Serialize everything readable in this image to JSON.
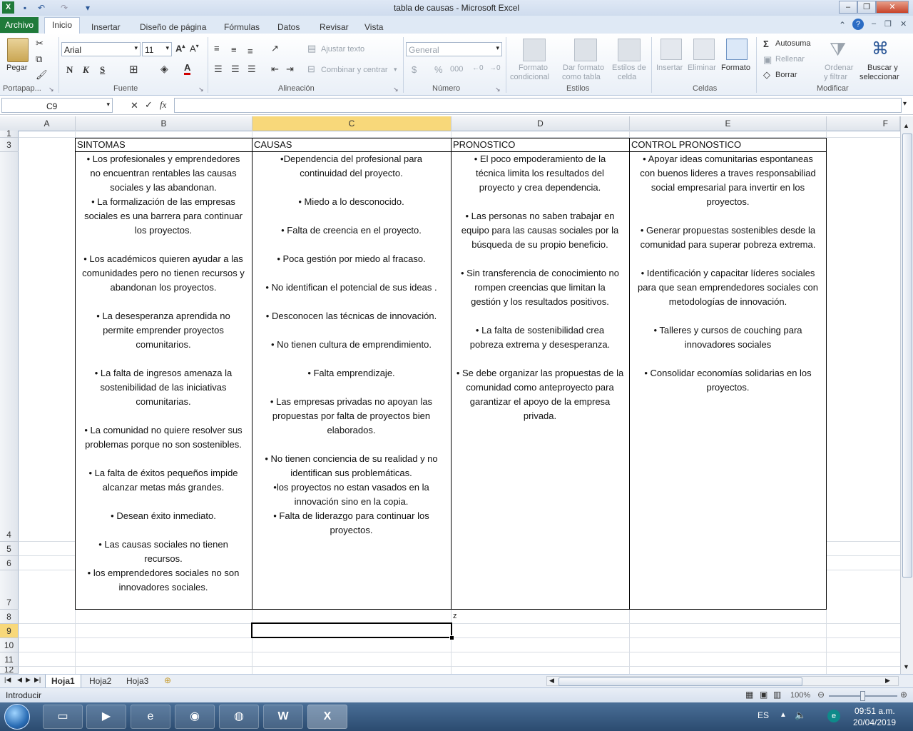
{
  "window": {
    "title": "tabla de causas - Microsoft Excel"
  },
  "tabs": [
    "Archivo",
    "Inicio",
    "Insertar",
    "Diseño de página",
    "Fórmulas",
    "Datos",
    "Revisar",
    "Vista"
  ],
  "ribbon": {
    "clipboard": {
      "paste": "Pegar",
      "group": "Portapap..."
    },
    "font": {
      "name": "Arial",
      "size": "11",
      "bold": "N",
      "italic": "K",
      "underline": "S",
      "color": "A",
      "group": "Fuente"
    },
    "alignment": {
      "wrap": "Ajustar texto",
      "merge": "Combinar y centrar",
      "group": "Alineación"
    },
    "number": {
      "format": "General",
      "currency": "$",
      "percent": "%",
      "thousands": "000",
      "group": "Número"
    },
    "styles": {
      "conditional_1": "Formato",
      "conditional_2": "condicional",
      "table_1": "Dar formato",
      "table_2": "como tabla",
      "cell_1": "Estilos de",
      "cell_2": "celda",
      "group": "Estilos"
    },
    "cells": {
      "insert": "Insertar",
      "delete": "Eliminar",
      "format": "Formato",
      "group": "Celdas"
    },
    "editing": {
      "autosum": "Autosuma",
      "fill": "Rellenar",
      "clear": "Borrar",
      "sort_1": "Ordenar",
      "sort_2": "y filtrar",
      "find_1": "Buscar y",
      "find_2": "seleccionar",
      "group": "Modificar"
    }
  },
  "formula_bar": {
    "name_box": "C9",
    "fx": "fx",
    "value": ""
  },
  "columns": [
    "A",
    "B",
    "C",
    "D",
    "E",
    "F"
  ],
  "rows": [
    "1",
    "3",
    "4",
    "5",
    "6",
    "7",
    "8",
    "9",
    "10",
    "11",
    "12"
  ],
  "table": {
    "headers": [
      "SINTOMAS",
      "CAUSAS",
      "PRONOSTICO",
      "CONTROL PRONOSTICO"
    ],
    "sintomas": "• Los profesionales y emprendedores\nno encuentran rentables las causas\nsociales y las abandonan.\n• La formalización de las empresas\nsociales es una barrera para continuar\nlos proyectos.\n\n• Los académicos quieren ayudar a las\ncomunidades pero no tienen recursos y\nabandonan los proyectos.\n\n• La desesperanza aprendida no\npermite emprender proyectos\ncomunitarios.\n\n• La falta de ingresos amenaza la\nsostenibilidad de las iniciativas\ncomunitarias.\n\n• La comunidad no quiere resolver sus\nproblemas porque no son sostenibles.\n\n• La falta de éxitos pequeños impide\nalcanzar metas más grandes.\n\n• Desean éxito inmediato.\n\n• Las causas sociales no tienen\nrecursos.\n• los emprendedores sociales no son\ninnovadores sociales.",
    "causas": "•Dependencia del profesional para\ncontinuidad del proyecto.\n\n• Miedo a lo desconocido.\n\n• Falta de creencia en el proyecto.\n\n• Poca  gestión por miedo al fracaso.\n\n• No identifican el potencial de sus ideas .\n\n• Desconocen las técnicas de innovación.\n\n• No tienen cultura de emprendimiento.\n\n• Falta emprendizaje.\n\n• Las empresas privadas no apoyan las\npropuestas por falta de proyectos bien\nelaborados.\n\n• No tienen conciencia de su realidad y no\nidentifican sus problemáticas.\n•los proyectos no estan vasados en la\ninnovación sino en la copia.\n• Falta de liderazgo para continuar los\nproyectos.",
    "pronostico": "• El poco empoderamiento de la\ntécnica limita los resultados del\nproyecto y crea dependencia.\n\n• Las personas no saben trabajar en\nequipo para las causas sociales por la\nbúsqueda de su propio beneficio.\n\n• Sin transferencia de conocimiento no\nrompen creencias que limitan la\ngestión y los resultados positivos.\n\n• La falta de sostenibilidad crea\npobreza extrema y desesperanza.\n\n• Se debe organizar las propuestas de la\ncomunidad como anteproyecto para\ngarantizar el apoyo de la empresa\nprivada.",
    "control": "• Apoyar ideas comunitarias espontaneas\ncon buenos lideres a traves responsabiliad\nsocial empresarial para invertir en los\nproyectos.\n\n• Generar propuestas sostenibles desde la\ncomunidad para superar pobreza extrema.\n\n• Identificación y capacitar líderes sociales\npara que sean emprendedores sociales con\nmetodologías de innovación.\n\n• Talleres y cursos de couching para\ninnovadores sociales\n\n• Consolidar economías solidarias en los\nproyectos."
  },
  "stray_cell": {
    "d8": "z"
  },
  "sheets": [
    "Hoja1",
    "Hoja2",
    "Hoja3"
  ],
  "status": {
    "mode": "Introducir",
    "zoom": "100%"
  },
  "taskbar": {
    "lang": "ES",
    "time": "09:51 a.m.",
    "date": "20/04/2019"
  },
  "colors": {
    "file_tab": "#1f7a3a",
    "selected_header": "#f8d87a",
    "taskbar": "#2b4b70"
  }
}
